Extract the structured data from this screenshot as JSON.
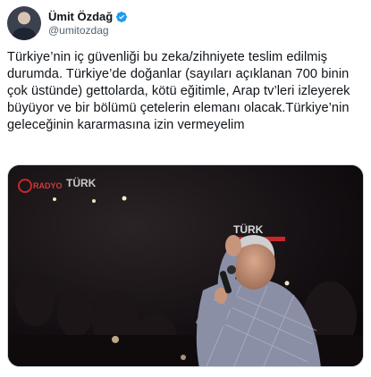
{
  "author": {
    "display_name": "Ümit Özdağ",
    "handle": "@umitozdag",
    "verified": true,
    "avatar_icon": "profile-photo"
  },
  "tweet": {
    "text": "Türkiye’nin iç güvenliği bu zeka/zihniyete teslim edilmiş durumda. Türkiye’de doğanlar (sayıları açıklanan 700 binin çok üstünde) gettolarda, kötü eğitimle, Arap tv’leri izleyerek büyüyor ve bir bölümü çetelerin elemanı olacak.Türkiye’nin geleceğinin kararmasına izin vermeyelim"
  },
  "media": {
    "watermark_line1": "TÜRK",
    "watermark_line2": "RADYO",
    "watermark_line3": "TÜRK"
  },
  "colors": {
    "verified_blue": "#1d9bf0",
    "text": "#0f1419",
    "secondary_text": "#536471",
    "border": "#cfd9de"
  }
}
